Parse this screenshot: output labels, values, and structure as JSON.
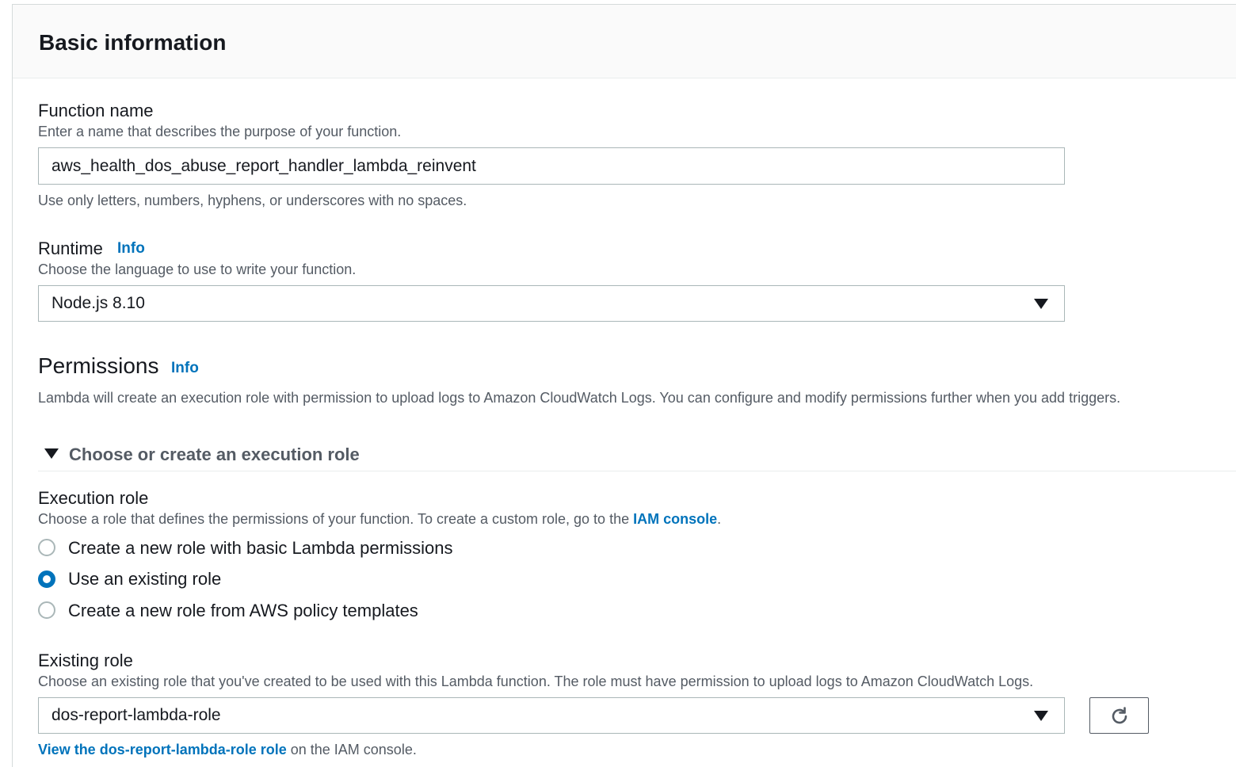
{
  "panel": {
    "title": "Basic information"
  },
  "function_name": {
    "label": "Function name",
    "description": "Enter a name that describes the purpose of your function.",
    "value": "aws_health_dos_abuse_report_handler_lambda_reinvent",
    "constraint": "Use only letters, numbers, hyphens, or underscores with no spaces."
  },
  "runtime": {
    "label": "Runtime",
    "info": "Info",
    "description": "Choose the language to use to write your function.",
    "selected": "Node.js 8.10"
  },
  "permissions": {
    "title": "Permissions",
    "info": "Info",
    "description": "Lambda will create an execution role with permission to upload logs to Amazon CloudWatch Logs. You can configure and modify permissions further when you add triggers."
  },
  "execution_role_expander": {
    "label": "Choose or create an execution role",
    "expanded": true
  },
  "execution_role": {
    "label": "Execution role",
    "description_prefix": "Choose a role that defines the permissions of your function. To create a custom role, go to the ",
    "description_link": "IAM console",
    "description_suffix": ".",
    "options": [
      {
        "label": "Create a new role with basic Lambda permissions",
        "checked": false
      },
      {
        "label": "Use an existing role",
        "checked": true
      },
      {
        "label": "Create a new role from AWS policy templates",
        "checked": false
      }
    ]
  },
  "existing_role": {
    "label": "Existing role",
    "description": "Choose an existing role that you've created to be used with this Lambda function. The role must have permission to upload logs to Amazon CloudWatch Logs.",
    "selected": "dos-report-lambda-role",
    "view_link": "View the dos-report-lambda-role role",
    "view_suffix": " on the IAM console."
  },
  "colors": {
    "link": "#0073bb",
    "radio_selected": "#0073bb",
    "text": "#16191f",
    "secondary_text": "#545b64"
  },
  "icons": {
    "refresh": "refresh-icon",
    "dropdown": "caret-down-icon",
    "expander": "caret-down-icon"
  }
}
